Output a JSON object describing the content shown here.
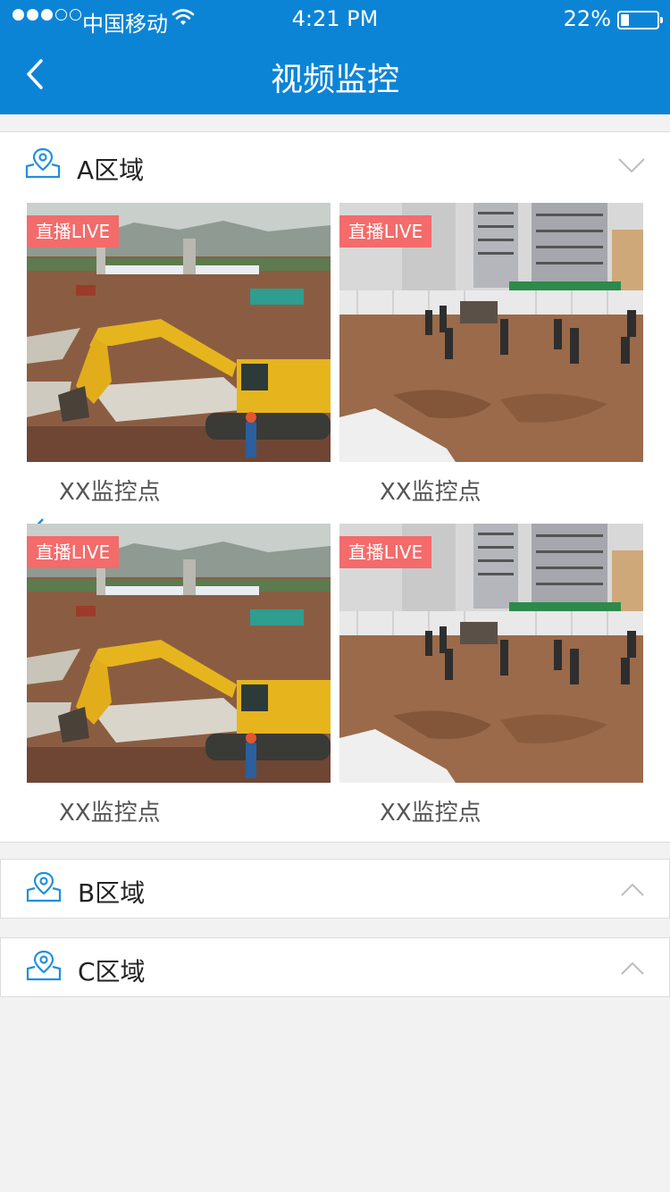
{
  "status_bar": {
    "carrier": "中国移动",
    "time": "4:21 PM",
    "battery_percent": "22%",
    "battery_level": 0.22,
    "signal_bars_filled": 3,
    "signal_bars_total": 5
  },
  "nav": {
    "title": "视频监控",
    "back_icon": "chevron-left-icon"
  },
  "colors": {
    "nav_bg": "#0c84d6",
    "live_badge": "#f36b6b",
    "accent_icon": "#1f8fdd"
  },
  "regions": [
    {
      "name": "A区域",
      "expanded": true,
      "chevron_icon": "chevron-down-icon",
      "cameras": [
        {
          "badge": "直播LIVE",
          "caption": "XX监控点",
          "scene": "excavator"
        },
        {
          "badge": "直播LIVE",
          "caption": "XX监控点",
          "scene": "workers"
        },
        {
          "badge": "直播LIVE",
          "caption": "XX监控点",
          "scene": "excavator"
        },
        {
          "badge": "直播LIVE",
          "caption": "XX监控点",
          "scene": "workers"
        }
      ]
    },
    {
      "name": "B区域",
      "expanded": false,
      "chevron_icon": "chevron-up-icon"
    },
    {
      "name": "C区域",
      "expanded": false,
      "chevron_icon": "chevron-up-icon"
    }
  ]
}
